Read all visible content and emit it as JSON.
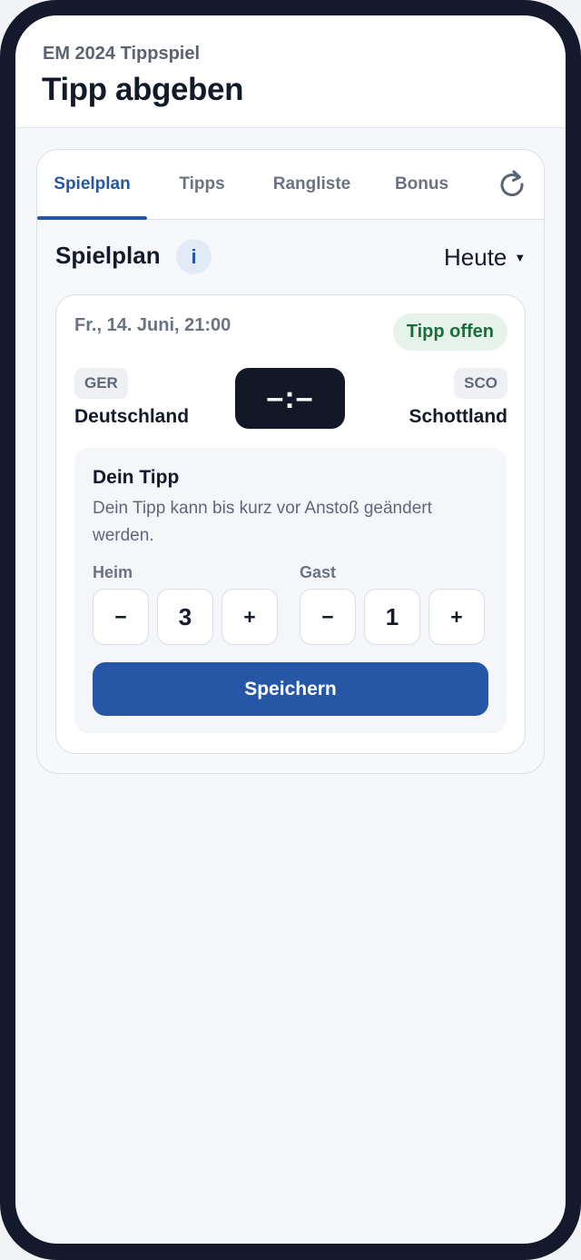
{
  "header": {
    "app_name": "EM 2024 Tippspiel",
    "title": "Tipp abgeben"
  },
  "tabs": [
    {
      "label": "Spielplan",
      "active": true
    },
    {
      "label": "Tipps",
      "active": false
    },
    {
      "label": "Rangliste",
      "active": false
    },
    {
      "label": "Bonus",
      "active": false
    }
  ],
  "toolbar": {
    "refresh_icon": "refresh-icon"
  },
  "section": {
    "title": "Spielplan",
    "info_label": "i",
    "filter_value": "Heute",
    "filter_icon": "caret-down-icon"
  },
  "match": {
    "kickoff": "Fr., 14. Juni, 21:00",
    "status": "Tipp offen",
    "home": {
      "code": "GER",
      "name": "Deutschland"
    },
    "away": {
      "code": "SCO",
      "name": "Schottland"
    },
    "score_display": "–:–"
  },
  "tip": {
    "title": "Dein Tipp",
    "hint": "Dein Tipp kann bis kurz vor Anstoß geändert werden.",
    "home_label": "Heim",
    "away_label": "Gast",
    "home_goals": "3",
    "away_goals": "1",
    "decrement_label": "−",
    "increment_label": "+",
    "save_label": "Speichern"
  },
  "colors": {
    "accent": "#2657a6",
    "status_open_bg": "#e6f3eb",
    "status_open_text": "#1c6d3b",
    "device_frame": "#141a2b"
  }
}
